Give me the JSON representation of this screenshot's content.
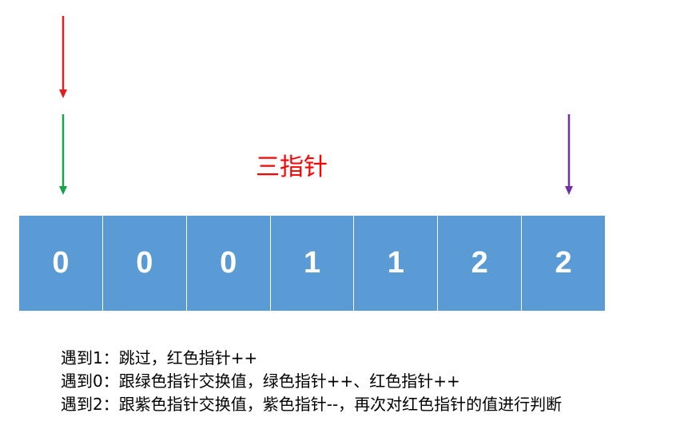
{
  "title": "三指针",
  "colors": {
    "red_pointer": "#e02020",
    "green_pointer": "#17a34a",
    "purple_pointer": "#7030a0",
    "cell_fill": "#5b9bd5",
    "title_color": "#ff0000"
  },
  "pointers": [
    {
      "name": "red",
      "color": "#e02020",
      "index": 0
    },
    {
      "name": "green",
      "color": "#17a34a",
      "index": 0
    },
    {
      "name": "purple",
      "color": "#7030a0",
      "index": 6
    }
  ],
  "array": [
    "0",
    "0",
    "0",
    "1",
    "1",
    "2",
    "2"
  ],
  "notes": [
    "遇到1：跳过，红色指针++",
    "遇到0：跟绿色指针交换值，绿色指针++、红色指针++",
    "遇到2：跟紫色指针交换值，紫色指针--，再次对红色指针的值进行判断"
  ]
}
